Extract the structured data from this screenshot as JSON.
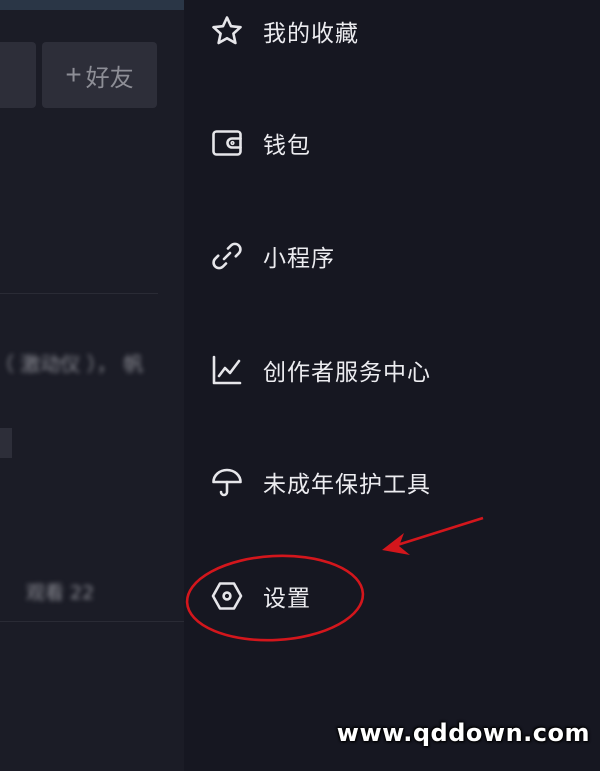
{
  "left_panel": {
    "add_friend_label": "好友",
    "add_friend_icon": "plus-icon",
    "blurred_line_1": "（ 激动仪 ）， 帆",
    "blurred_meta": "观看 22"
  },
  "drawer": {
    "items": [
      {
        "label": "我的收藏",
        "icon": "star-icon"
      },
      {
        "label": "钱包",
        "icon": "wallet-icon"
      },
      {
        "label": "小程序",
        "icon": "link-icon"
      },
      {
        "label": "创作者服务中心",
        "icon": "chart-icon"
      },
      {
        "label": "未成年保护工具",
        "icon": "umbrella-icon"
      },
      {
        "label": "设置",
        "icon": "hexagon-settings-icon"
      }
    ]
  },
  "annotation": {
    "highlight_color": "#d3161c",
    "arrow_target": "设置"
  },
  "watermark": "www.qddown.com",
  "colors": {
    "background": "#161721",
    "text": "#ececf0",
    "left_panel": "#1b1c26"
  }
}
